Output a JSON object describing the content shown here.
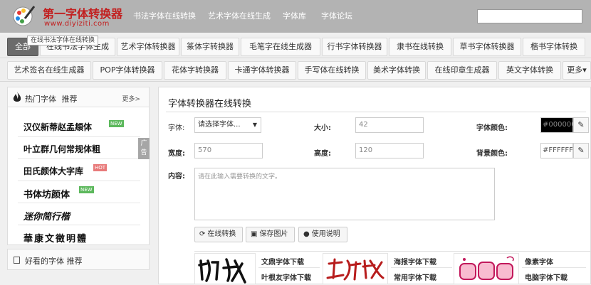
{
  "logo": {
    "title": "第一字体转换器",
    "sub": "www.diyiziti.com"
  },
  "topnav": [
    "书法字体在线转换",
    "艺术字体在线生成",
    "字体库",
    "字体论坛"
  ],
  "nav_row1": [
    "全部",
    "在线书法字体生成",
    "艺术字体转换器",
    "篆体字转换器",
    "毛笔字在线生成器",
    "行书字体转换器",
    "隶书在线转换",
    "草书字体转换器",
    "楷书字体转换"
  ],
  "nav_row2": [
    "艺术签名在线生成器",
    "POP字体转换器",
    "花体字转换器",
    "卡通字体转换器",
    "手写体在线转换",
    "美术字体转换",
    "在线印章生成器",
    "英文字体转换",
    "更多▾"
  ],
  "tooltip": "在线书法字体在线转换",
  "sidebar": {
    "title": "热门字体",
    "title2": "推荐",
    "more": "更多>",
    "items": [
      {
        "name": "汉仪新蒂赵孟頫体",
        "tag": "NEW"
      },
      {
        "name": "叶立群几何常规体粗",
        "tag": ""
      },
      {
        "name": "田氏颜体大字库",
        "tag": "HOT"
      },
      {
        "name": "书体坊颜体",
        "tag": "NEW"
      },
      {
        "name": "迷你简行楷",
        "tag": ""
      },
      {
        "name": "華康文徵明體",
        "tag": ""
      }
    ],
    "ad": "广告",
    "section2": "好看的字体 推荐"
  },
  "tag_colors": {
    "NEW": "#5cb85c",
    "HOT": "#e87a7a"
  },
  "main": {
    "title": "字体转换器在线转换",
    "font_label": "字体:",
    "font_select": "请选择字体...",
    "size_label": "大小:",
    "size_value": "42",
    "color_label": "字体颜色:",
    "color_value": "#000000",
    "width_label": "宽度:",
    "width_value": "570",
    "height_label": "高度:",
    "height_value": "120",
    "bg_label": "背景颜色:",
    "bg_value": "#FFFFFF",
    "content_label": "内容:",
    "content_placeholder": "请在此输入需要转换的文字。",
    "btn_convert": "在线转换",
    "btn_save": "保存图片",
    "btn_help": "使用说明",
    "showcase_links": [
      "文鼎字体下载",
      "叶根友字体下载",
      "海报字体下载",
      "常用字体下载",
      "像素字体",
      "电脑字体下载"
    ]
  }
}
